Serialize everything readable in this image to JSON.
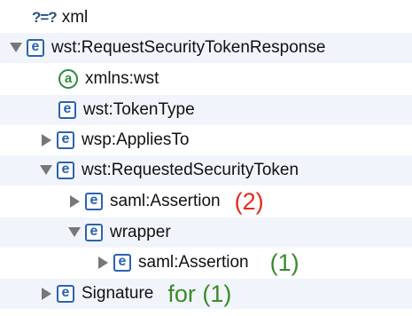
{
  "pi": {
    "icon": "?=?",
    "label": "xml"
  },
  "rows": [
    {
      "label": "wst:RequestSecurityTokenResponse"
    },
    {
      "label": "xmlns:wst"
    },
    {
      "label": "wst:TokenType"
    },
    {
      "label": "wsp:AppliesTo"
    },
    {
      "label": "wst:RequestedSecurityToken"
    },
    {
      "label": "saml:Assertion",
      "note": "(2)"
    },
    {
      "label": "wrapper"
    },
    {
      "label": "saml:Assertion",
      "note": "(1)"
    },
    {
      "label": "Signature",
      "note": "for (1)"
    }
  ],
  "icons": {
    "element": "e",
    "attribute": "a"
  },
  "colors": {
    "note_red": "#e8281e",
    "note_green": "#3a8a2c",
    "row_alt": "#f1f5fb",
    "icon_blue": "#2a63b2",
    "attr_green": "#2d8a3a"
  }
}
